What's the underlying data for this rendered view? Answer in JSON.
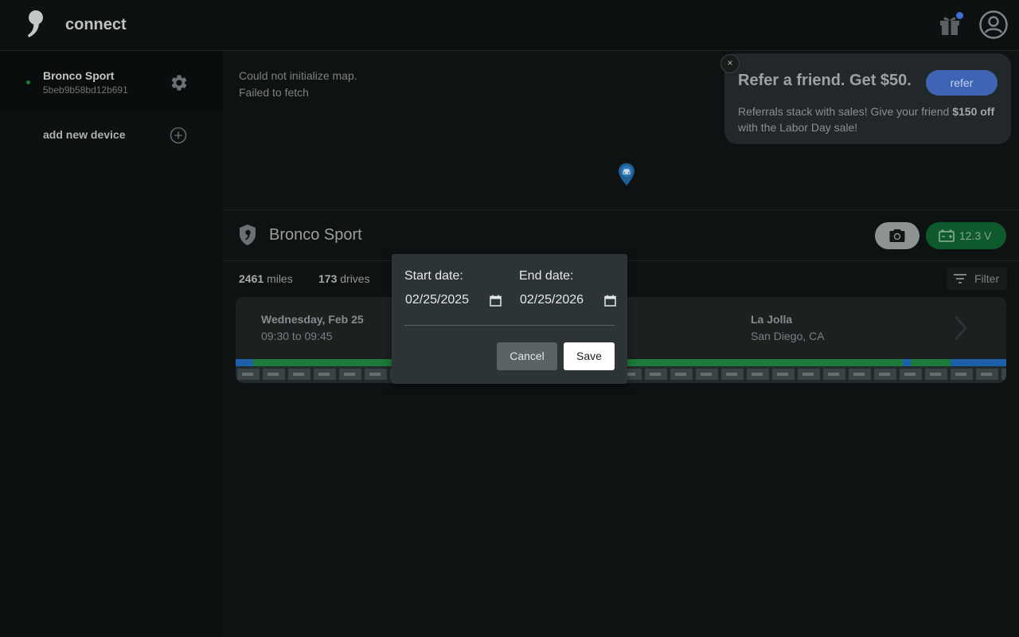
{
  "app": {
    "title": "connect"
  },
  "sidebar": {
    "device": {
      "name": "Bronco Sport",
      "id": "5beb9b58bd12b691"
    },
    "add_device_label": "add new device"
  },
  "map": {
    "error_line1": "Could not initialize map.",
    "error_line2": "Failed to fetch"
  },
  "referral": {
    "close": "×",
    "title": "Refer a friend. Get $50.",
    "button": "refer",
    "text_before": "Referrals stack with sales! Give your friend ",
    "text_bold": "$150 off",
    "text_after": " with the Labor Day sale!"
  },
  "vehicle": {
    "title": "Bronco Sport",
    "battery": "12.3 V"
  },
  "stats": {
    "miles_value": "2461",
    "miles_label": " miles",
    "drives_value": "173",
    "drives_label": " drives",
    "filter_label": "Filter"
  },
  "drive": {
    "date": "Wednesday, Feb 25",
    "time": "09:30 to 09:45",
    "dest_name": "La Jolla",
    "dest_city": "San Diego, CA"
  },
  "date_filter": {
    "start_label": "Start date:",
    "start_value": "02/25/2025",
    "end_label": "End date:",
    "end_value": "02/25/2026",
    "cancel": "Cancel",
    "save": "Save"
  },
  "colors": {
    "background": "#0e1212",
    "refer_button": "#3f63b5",
    "battery": "#0f5a2c",
    "online": "#1e7a3a",
    "notification_dot": "#3d6fd6"
  },
  "icons": {
    "logo": "comma-logo-icon",
    "gift": "gift-icon",
    "account": "account-icon",
    "settings": "gear-icon",
    "add": "plus-circle-icon",
    "map_pin": "car-pin-icon",
    "shield": "shield-icon",
    "camera": "camera-icon",
    "battery": "battery-icon",
    "filter": "filter-icon",
    "chevron": "chevron-right-icon",
    "calendar": "calendar-icon"
  }
}
